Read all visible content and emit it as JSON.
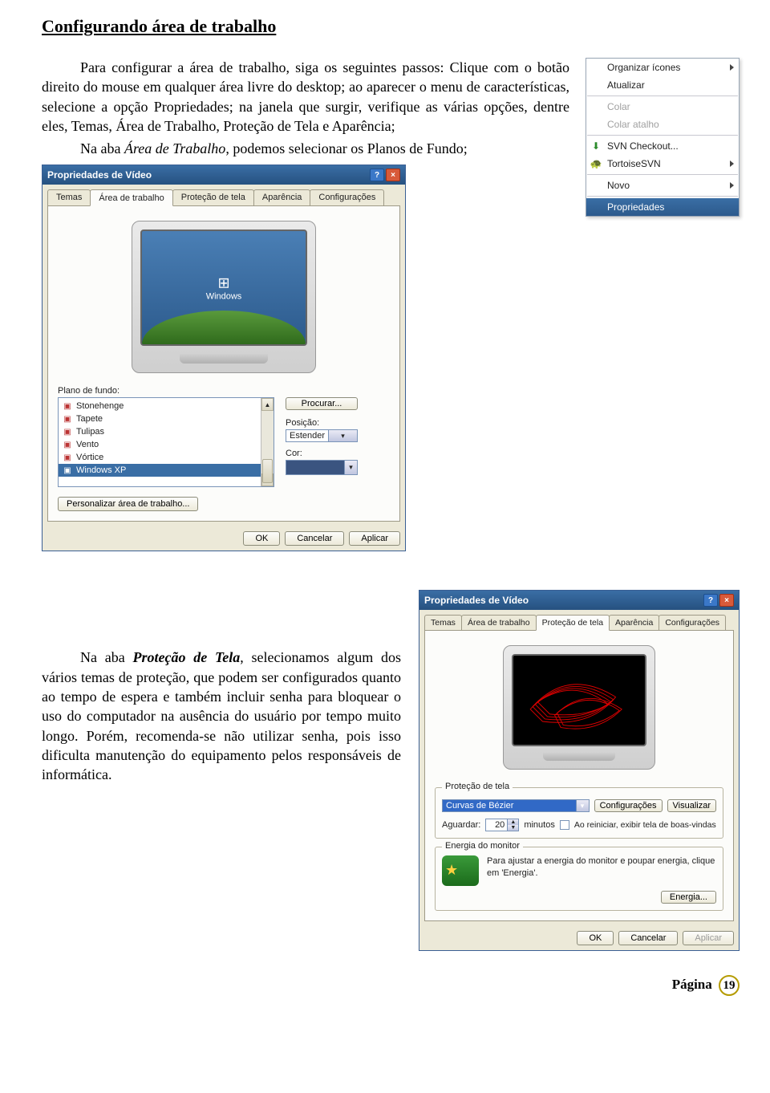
{
  "document": {
    "title": "Configurando área de trabalho",
    "para1_part1": "Para configurar a área de trabalho, siga os seguintes passos: Clique com o botão direito do mouse em qualquer área livre do desktop; ao aparecer o menu de características, selecione a opção Propriedades; na janela que surgir, verifique as várias opções, dentre eles, Temas, Área de Trabalho, Proteção de Tela e Aparência;",
    "para1_part2a": "Na aba ",
    "para1_part2b": "Área de Trabalho",
    "para1_part2c": ", podemos selecionar os Planos de Fundo;",
    "para2_a": "Na aba ",
    "para2_b": "Proteção de Tela",
    "para2_c": ", selecionamos algum dos vários temas de proteção, que podem ser configurados quanto ao tempo de espera e também incluir senha para bloquear o uso do computador na ausência do usuário por tempo muito longo. Porém, recomenda-se não utilizar senha, pois isso dificulta manutenção do equipamento pelos responsáveis de informática.",
    "footer_label": "Página",
    "page_number": "19"
  },
  "context_menu": {
    "organize": "Organizar ícones",
    "refresh": "Atualizar",
    "paste": "Colar",
    "paste_shortcut": "Colar atalho",
    "svn_checkout": "SVN Checkout...",
    "tortoise": "TortoiseSVN",
    "new": "Novo",
    "properties": "Propriedades"
  },
  "dialog1": {
    "title": "Propriedades de Vídeo",
    "tabs": {
      "temas": "Temas",
      "area": "Área de trabalho",
      "protecao": "Proteção de tela",
      "aparencia": "Aparência",
      "config": "Configurações"
    },
    "bg_label": "Plano de fundo:",
    "bg_items": [
      "Stonehenge",
      "Tapete",
      "Tulipas",
      "Vento",
      "Vórtice",
      "Windows XP"
    ],
    "browse_btn": "Procurar...",
    "position_label": "Posição:",
    "position_value": "Estender",
    "color_label": "Cor:",
    "customize_btn": "Personalizar área de trabalho...",
    "xp_text": "Windows",
    "ok": "OK",
    "cancel": "Cancelar",
    "apply": "Aplicar"
  },
  "dialog2": {
    "title": "Propriedades de Vídeo",
    "tabs": {
      "temas": "Temas",
      "area": "Área de trabalho",
      "protecao": "Proteção de tela",
      "aparencia": "Aparência",
      "config": "Configurações"
    },
    "ss_group": "Proteção de tela",
    "ss_name": "Curvas de Bézier",
    "settings_btn": "Configurações",
    "preview_btn": "Visualizar",
    "wait_label_pre": "Aguardar:",
    "wait_value": "20",
    "wait_unit": "minutos",
    "welcome_chk": "Ao reiniciar, exibir tela de boas-vindas",
    "energy_group": "Energia do monitor",
    "energy_text": "Para ajustar a energia do monitor e poupar energia, clique em 'Energia'.",
    "energy_btn": "Energia...",
    "ok": "OK",
    "cancel": "Cancelar",
    "apply": "Aplicar"
  }
}
